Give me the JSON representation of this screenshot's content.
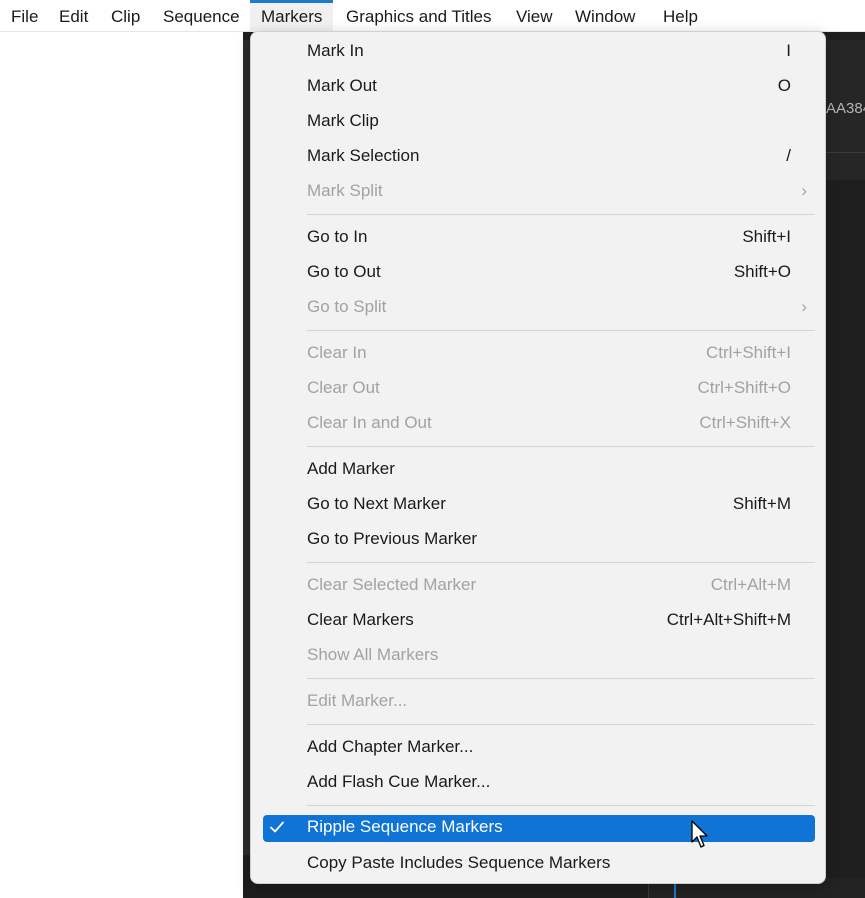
{
  "menubar": {
    "items": [
      {
        "label": "File"
      },
      {
        "label": "Edit"
      },
      {
        "label": "Clip"
      },
      {
        "label": "Sequence"
      },
      {
        "label": "Markers"
      },
      {
        "label": "Graphics and Titles"
      },
      {
        "label": "View"
      },
      {
        "label": "Window"
      },
      {
        "label": "Help"
      }
    ],
    "active": "Markers"
  },
  "background": {
    "fragment_top_right": "AA384"
  },
  "markers_menu": {
    "items": [
      {
        "label": "Mark In",
        "shortcut": "I",
        "enabled": true
      },
      {
        "label": "Mark Out",
        "shortcut": "O",
        "enabled": true
      },
      {
        "label": "Mark Clip",
        "shortcut": "",
        "enabled": true
      },
      {
        "label": "Mark Selection",
        "shortcut": "/",
        "enabled": true
      },
      {
        "label": "Mark Split",
        "shortcut": "",
        "enabled": false,
        "submenu": true
      },
      {
        "label": "Go to In",
        "shortcut": "Shift+I",
        "enabled": true
      },
      {
        "label": "Go to Out",
        "shortcut": "Shift+O",
        "enabled": true
      },
      {
        "label": "Go to Split",
        "shortcut": "",
        "enabled": false,
        "submenu": true
      },
      {
        "label": "Clear In",
        "shortcut": "Ctrl+Shift+I",
        "enabled": false
      },
      {
        "label": "Clear Out",
        "shortcut": "Ctrl+Shift+O",
        "enabled": false
      },
      {
        "label": "Clear In and Out",
        "shortcut": "Ctrl+Shift+X",
        "enabled": false
      },
      {
        "label": "Add Marker",
        "shortcut": "",
        "enabled": true
      },
      {
        "label": "Go to Next Marker",
        "shortcut": "Shift+M",
        "enabled": true
      },
      {
        "label": "Go to Previous Marker",
        "shortcut": "",
        "enabled": true
      },
      {
        "label": "Clear Selected Marker",
        "shortcut": "Ctrl+Alt+M",
        "enabled": false
      },
      {
        "label": "Clear Markers",
        "shortcut": "Ctrl+Alt+Shift+M",
        "enabled": true
      },
      {
        "label": "Show All Markers",
        "shortcut": "",
        "enabled": false
      },
      {
        "label": "Edit Marker...",
        "shortcut": "",
        "enabled": false
      },
      {
        "label": "Add Chapter Marker...",
        "shortcut": "",
        "enabled": true
      },
      {
        "label": "Add Flash Cue Marker...",
        "shortcut": "",
        "enabled": true
      },
      {
        "label": "Ripple Sequence Markers",
        "shortcut": "",
        "enabled": true,
        "checked": true,
        "highlighted": true
      },
      {
        "label": "Copy Paste Includes Sequence Markers",
        "shortcut": "",
        "enabled": true
      }
    ],
    "submenu_glyph": "›",
    "check_icon": "checkmark-icon"
  },
  "colors": {
    "highlight": "#0f74d6",
    "menu_bg": "#f2f2f2",
    "disabled_text": "#a2a2a2",
    "app_dark": "#1e1e1e"
  }
}
